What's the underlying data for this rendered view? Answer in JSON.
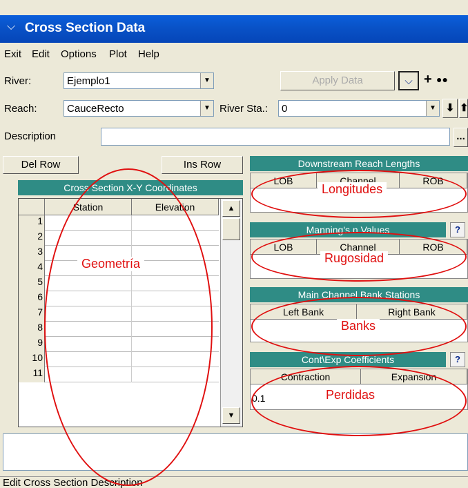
{
  "window": {
    "title": "Cross Section Data"
  },
  "menu": [
    "Exit",
    "Edit",
    "Options",
    "Plot",
    "Help"
  ],
  "river": {
    "label": "River:",
    "value": "Ejemplo1"
  },
  "reach": {
    "label": "Reach:",
    "value": "CauceRecto"
  },
  "river_sta": {
    "label": "River Sta.:",
    "value": "0"
  },
  "apply_button": "Apply Data",
  "description": {
    "label": "Description",
    "value": "",
    "more_button": "..."
  },
  "grid": {
    "del_row": "Del Row",
    "ins_row": "Ins Row",
    "title": "Cross Section X-Y Coordinates",
    "columns": [
      "Station",
      "Elevation"
    ],
    "row_numbers": [
      "1",
      "2",
      "3",
      "4",
      "5",
      "6",
      "7",
      "8",
      "9",
      "10",
      "11"
    ]
  },
  "downstream": {
    "title": "Downstream Reach Lengths",
    "cols": [
      "LOB",
      "Channel",
      "ROB"
    ]
  },
  "manning": {
    "title": "Manning's n Values",
    "cols": [
      "LOB",
      "Channel",
      "ROB"
    ]
  },
  "bank": {
    "title": "Main Channel Bank Stations",
    "cols": [
      "Left Bank",
      "Right Bank"
    ]
  },
  "coef": {
    "title": "Cont\\Exp Coefficients",
    "cols": [
      "Contraction",
      "Expansion"
    ],
    "contraction_value": "0.1"
  },
  "annotations": {
    "geometria": "Geometría",
    "longitudes": "Longitudes",
    "rugosidad": "Rugosidad",
    "banks": "Banks",
    "perdidas": "Perdidas"
  },
  "status": "Edit Cross Section Description",
  "colors": {
    "accent": "#2f8c85",
    "annotation": "#e01010",
    "title_bar": "#0a5edb"
  }
}
